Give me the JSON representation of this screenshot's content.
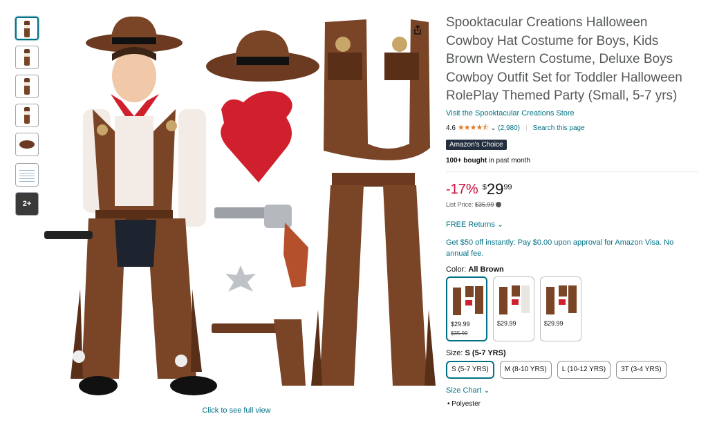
{
  "product": {
    "title": "Spooktacular Creations Halloween Cowboy Hat Costume for Boys, Kids Brown Western Costume, Deluxe Boys Cowboy Outfit Set for Toddler Halloween RolePlay Themed Party (Small, 5-7 yrs)",
    "store_link": "Visit the Spooktacular Creations Store",
    "rating_value": "4.6",
    "stars": "★★★★⯪",
    "rating_count": "(2,980)",
    "search_page": "Search this page",
    "badge": "Amazon's Choice",
    "bought_strong": "100+ bought",
    "bought_rest": " in past month",
    "discount": "-17%",
    "currency": "$",
    "price_whole": "29",
    "price_fraction": "99",
    "list_price_label": "List Price: ",
    "list_price": "$35.99",
    "returns": "FREE Returns",
    "promo": "Get $50 off instantly: Pay $0.00 upon approval for Amazon Visa. No annual fee.",
    "color_label": "Color: ",
    "color_value": "All Brown",
    "size_label": "Size: ",
    "size_value": "S (5-7 YRS)",
    "size_chart": "Size Chart",
    "material": "Polyester"
  },
  "swatches": [
    {
      "price": "$29.99",
      "old": "$35.99"
    },
    {
      "price": "$29.99",
      "old": ""
    },
    {
      "price": "$29.99",
      "old": ""
    }
  ],
  "sizes": [
    "S (5-7 YRS)",
    "M (8-10 YRS)",
    "L (10-12 YRS)",
    "3T (3-4 YRS)"
  ],
  "gallery": {
    "more_label": "2+",
    "caption": "Click to see full view"
  },
  "colors": {
    "link": "#007185",
    "deal": "#cc0c39",
    "star": "#de7921",
    "badge": "#232f3e",
    "costume": "#7a4526"
  }
}
